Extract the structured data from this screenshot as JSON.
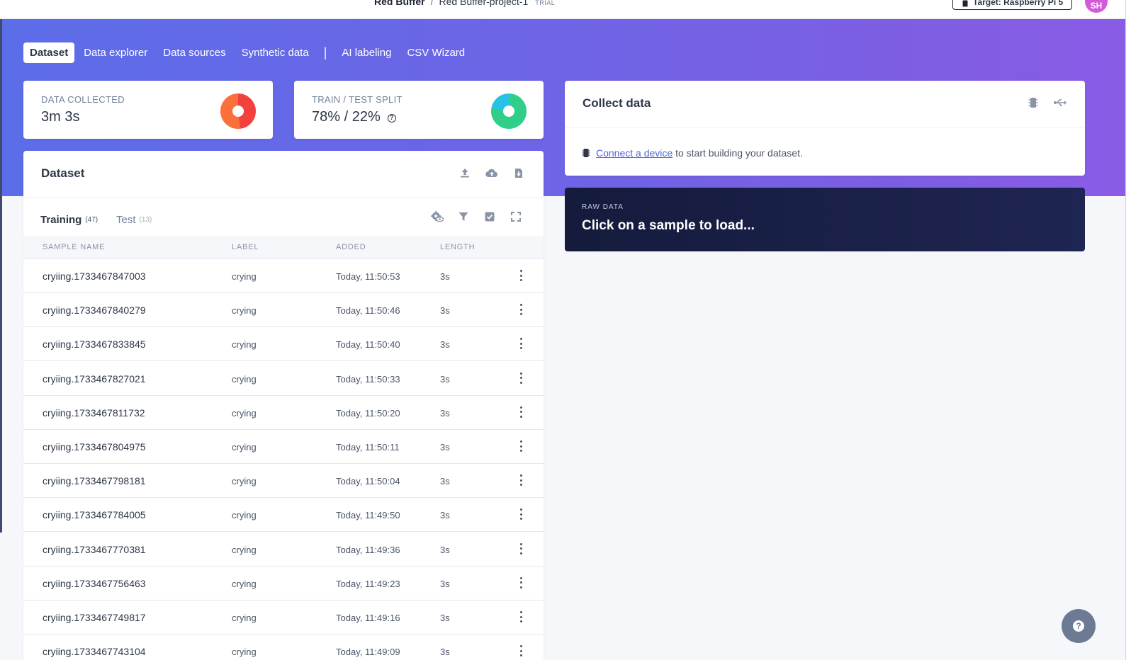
{
  "header": {
    "project_owner": "Red Buffer",
    "separator": "/",
    "project_name": "Red Buffer-project-1",
    "plan_badge": "TRIAL",
    "target_button": "Target: Raspberry Pi 5",
    "avatar_initials": "SH"
  },
  "tabs": [
    {
      "label": "Dataset",
      "active": true
    },
    {
      "label": "Data explorer"
    },
    {
      "label": "Data sources"
    },
    {
      "label": "Synthetic data"
    },
    {
      "label": "AI labeling"
    },
    {
      "label": "CSV Wizard"
    }
  ],
  "stats": {
    "collected": {
      "label": "DATA COLLECTED",
      "value": "3m 3s",
      "donut_colors": [
        "#f3423e",
        "#fb6f3a"
      ]
    },
    "split": {
      "label": "TRAIN / TEST SPLIT",
      "value": "78% / 22%",
      "train_fraction": 0.78,
      "donut_colors": [
        "#2fcf8a",
        "#26c2e6"
      ]
    }
  },
  "dataset": {
    "title": "Dataset",
    "icons": [
      "upload-icon",
      "cloud-upload-icon",
      "download-file-icon"
    ],
    "subtabs": {
      "training": {
        "label": "Training",
        "count": "(47)"
      },
      "test": {
        "label": "Test",
        "count": "(13)"
      }
    },
    "toolbar_icons": [
      "settings-eye-icon",
      "filter-icon",
      "checkbox-icon",
      "expand-icon"
    ],
    "columns": [
      "SAMPLE NAME",
      "LABEL",
      "ADDED",
      "LENGTH"
    ],
    "rows": [
      {
        "name": "cryiing.1733467847003",
        "label": "crying",
        "added": "Today, 11:50:53",
        "length": "3s"
      },
      {
        "name": "cryiing.1733467840279",
        "label": "crying",
        "added": "Today, 11:50:46",
        "length": "3s"
      },
      {
        "name": "cryiing.1733467833845",
        "label": "crying",
        "added": "Today, 11:50:40",
        "length": "3s"
      },
      {
        "name": "cryiing.1733467827021",
        "label": "crying",
        "added": "Today, 11:50:33",
        "length": "3s"
      },
      {
        "name": "cryiing.1733467811732",
        "label": "crying",
        "added": "Today, 11:50:20",
        "length": "3s"
      },
      {
        "name": "cryiing.1733467804975",
        "label": "crying",
        "added": "Today, 11:50:11",
        "length": "3s"
      },
      {
        "name": "cryiing.1733467798181",
        "label": "crying",
        "added": "Today, 11:50:04",
        "length": "3s"
      },
      {
        "name": "cryiing.1733467784005",
        "label": "crying",
        "added": "Today, 11:49:50",
        "length": "3s"
      },
      {
        "name": "cryiing.1733467770381",
        "label": "crying",
        "added": "Today, 11:49:36",
        "length": "3s"
      },
      {
        "name": "cryiing.1733467756463",
        "label": "crying",
        "added": "Today, 11:49:23",
        "length": "3s"
      },
      {
        "name": "cryiing.1733467749817",
        "label": "crying",
        "added": "Today, 11:49:16",
        "length": "3s"
      },
      {
        "name": "cryiing.1733467743104",
        "label": "crying",
        "added": "Today, 11:49:09",
        "length": "3s"
      }
    ]
  },
  "collect": {
    "title": "Collect data",
    "icons": [
      "chip-icon",
      "usb-icon"
    ],
    "link_text": "Connect a device",
    "rest_text": "to start building your dataset."
  },
  "raw_data": {
    "label": "RAW DATA",
    "title": "Click on a sample to load..."
  },
  "help_icon": "help-icon"
}
